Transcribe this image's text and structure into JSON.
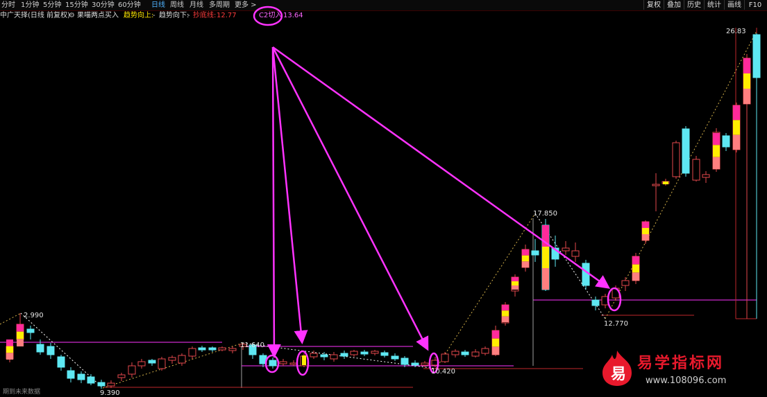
{
  "toolbar": {
    "periods": [
      "分时",
      "1分钟",
      "5分钟",
      "15分钟",
      "30分钟",
      "60分钟",
      "日线",
      "周线",
      "月线",
      "多周期",
      "更多 >"
    ],
    "active_period": "日线",
    "right_buttons": [
      "复权",
      "叠加",
      "历史",
      "统计",
      "画线",
      "F10"
    ]
  },
  "legend": {
    "title": "中广天择(日线 前复权)",
    "strategy_icon": "gear-icon",
    "strategy": "果喵两点买入",
    "trend_up_label": "趋势向上:",
    "trend_up_value": "-",
    "trend_down_label": "趋势向下:",
    "trend_down_value": "-",
    "bottom_line_label": "抄底线:",
    "bottom_line_value": "12.77",
    "c2_label": "C2切入",
    "c2_value": "13.64"
  },
  "price_labels": {
    "p_2990": "2.990",
    "p_9390": "9.390",
    "p_11640": "11.640",
    "p_10420": "10.420",
    "p_17850": "17.850",
    "p_12770": "12.770",
    "p_2683": "26.83"
  },
  "footer_note": "期到未来数据",
  "watermark": {
    "logo_char": "易",
    "title": "易学指标网",
    "url": "www.108096.com"
  },
  "colors": {
    "background": "#000000",
    "up_candle": "#e5484d",
    "down_candle": "#5ee7f2",
    "annotation": "#ff33ff",
    "marker_yellow": "#ffee00",
    "marker_pink": "#ff2a9a",
    "marker_salmon": "#ff7f7f"
  }
}
